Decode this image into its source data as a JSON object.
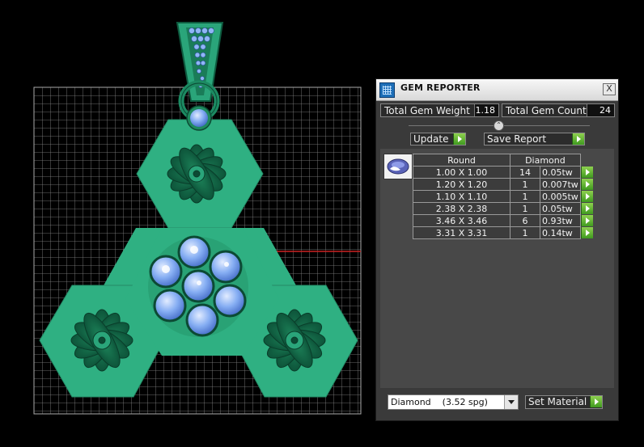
{
  "viewport": {
    "grid_color": "#9a9a9a",
    "axis_color": "#cc2222",
    "metal_color": "#2fb082",
    "gem_color": "#7fa9f0",
    "content": "green jewelry pendant with blue round gems"
  },
  "panel": {
    "title": "GEM REPORTER",
    "close_label": "X",
    "total_gem_weight_label": "Total Gem Weight",
    "total_gem_weight": "1.18",
    "total_gem_count_label": "Total Gem Count",
    "total_gem_count": "24",
    "update_label": "Update",
    "save_report_label": "Save Report",
    "table": {
      "shape_header": "Round",
      "material_header": "Diamond",
      "rows": [
        {
          "size": "1.00 X 1.00",
          "count": "14",
          "ctw": "0.05tw"
        },
        {
          "size": "1.20 X 1.20",
          "count": "1",
          "ctw": "0.007tw"
        },
        {
          "size": "1.10 X 1.10",
          "count": "1",
          "ctw": "0.005tw"
        },
        {
          "size": "2.38 X 2.38",
          "count": "1",
          "ctw": "0.05tw"
        },
        {
          "size": "3.46 X 3.46",
          "count": "6",
          "ctw": "0.93tw"
        },
        {
          "size": "3.31 X 3.31",
          "count": "1",
          "ctw": "0.14tw"
        }
      ]
    },
    "material_select": "Diamond    (3.52 spg)",
    "set_material_label": "Set Material"
  }
}
